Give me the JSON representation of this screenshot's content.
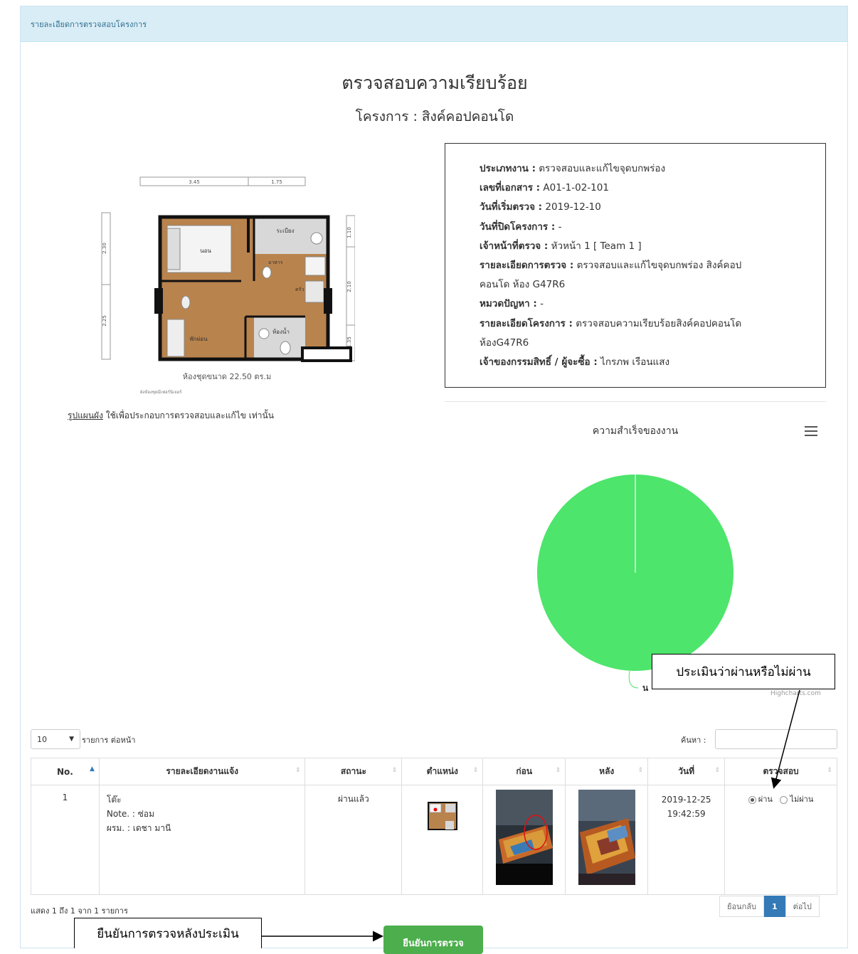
{
  "breadcrumb": "รายละเอียดการตรวจสอบโครงการ",
  "page_title": "ตรวจสอบความเรียบร้อย",
  "project_title": "โครงการ : สิงค์คอปคอนโด",
  "floorplan": {
    "dims_top": [
      "3.45",
      "1.75"
    ],
    "dims_left": [
      "2.30",
      "2.25"
    ],
    "dims_right": [
      "1.10",
      "2.10",
      "1.35"
    ],
    "room_bed": "นอน",
    "room_wash": "ระเบียง",
    "room_kitchen": "ครัว",
    "room_food": "อาหาร",
    "room_living": "พักผ่อน",
    "room_bath": "ห้องน้ำ",
    "caption": "ห้องชุดขนาด 22.50 ตร.ม",
    "subcaption": "ผังห้องชุดมีเฟอร์นิเจอร์"
  },
  "plan_note": {
    "link": "รูปแผนผัง",
    "text": " ใช้เพื่อประกอบการตรวจสอบและแก้ไข เท่านั้น"
  },
  "info": {
    "type_label": "ประเภทงาน :",
    "type_value": " ตรวจสอบและแก้ไขจุดบกพร่อง",
    "doc_label": "เลขที่เอกสาร :",
    "doc_value": " A01-1-02-101",
    "start_label": "วันที่เริ่มตรวจ :",
    "start_value": " 2019-12-10",
    "close_label": "วันที่ปิดโครงการ :",
    "close_value": " -",
    "officer_label": "เจ้าหน้าที่ตรวจ :",
    "officer_value": " หัวหน้า 1 [ Team 1 ]",
    "detail_label": "รายละเอียดการตรวจ :",
    "detail_value": " ตรวจสอบและแก้ไขจุดบกพร่อง สิงค์คอป",
    "detail_value2": "คอนโด ห้อง G47R6",
    "category_label": "หมวดปัญหา :",
    "category_value": " -",
    "project_detail_label": "รายละเอียดโครงการ :",
    "project_detail_value": " ตรวจสอบความเรียบร้อยสิงค์คอปคอนโด",
    "project_detail_value2": "ห้องG47R6",
    "owner_label": "เจ้าของกรรมสิทธิ์ / ผู้จะซื้อ :",
    "owner_value": " ไกรภพ เรือนแสง"
  },
  "chart": {
    "title": "ความสำเร็จของงาน",
    "credits": "Highcharts.com",
    "label_partial": "น",
    "menu_icon": "hamburger-icon"
  },
  "chart_data": {
    "type": "pie",
    "title": "ความสำเร็จของงาน",
    "slices": [
      {
        "label": "",
        "value": 100,
        "color": "#4de56b"
      }
    ]
  },
  "callouts": {
    "assess": "ประเมินว่าผ่านหรือไม่ผ่าน",
    "confirm": "ยืนยันการตรวจหลังประเมิน"
  },
  "table_controls": {
    "length_value": "10",
    "length_label": "รายการ ต่อหน้า",
    "search_label": "ค้นหา :"
  },
  "table": {
    "headers": [
      "No.",
      "รายละเอียดงานแจ้ง",
      "สถานะ",
      "ตำแหน่ง",
      "ก่อน",
      "หลัง",
      "วันที่",
      "ตรวจสอบ"
    ],
    "rows": [
      {
        "no": "1",
        "detail_1": "โต๊ะ",
        "detail_2": "Note. : ซ่อม",
        "detail_3": "ผรม. : เดชา มานี",
        "status": "ผ่านแล้ว",
        "date": "2019-12-25",
        "time": "19:42:59",
        "pass_label": "ผ่าน",
        "fail_label": "ไม่ผ่าน"
      }
    ]
  },
  "footer": {
    "info": "แสดง 1 ถึง 1 จาก 1 รายการ",
    "prev": "ย้อนกลับ",
    "page": "1",
    "next": "ต่อไป",
    "confirm_button": "ยืนยันการตรวจ"
  },
  "colors": {
    "heading_bg": "#d9edf7",
    "pie_green": "#4de56b",
    "button_green": "#4cae4c",
    "pager_active": "#337ab7"
  }
}
